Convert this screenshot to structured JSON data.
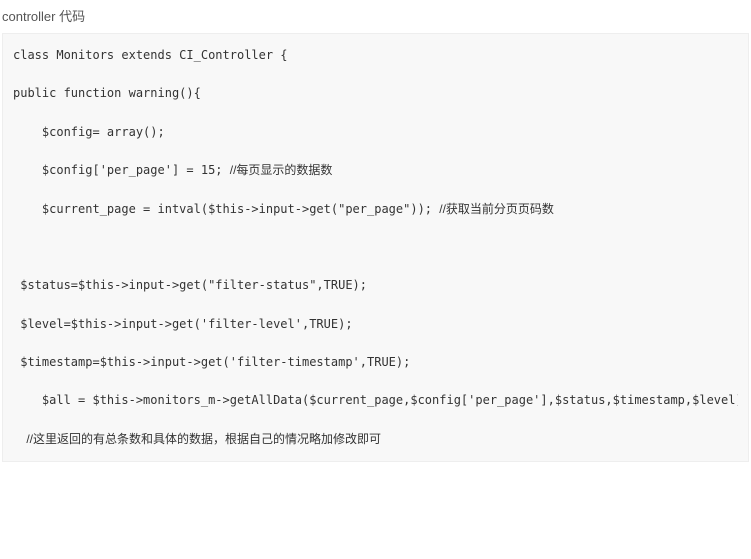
{
  "title": "controller 代码",
  "code": {
    "l1": "class Monitors extends CI_Controller {",
    "l2": "public function warning(){",
    "l3": "    $config= array();",
    "l4": "    $config['per_page'] = 15; ",
    "c4": "//每页显示的数据数",
    "l5": "    $current_page = intval($this->input->get(\"per_page\")); ",
    "c5": "//获取当前分页页码数",
    "l6": " $status=$this->input->get(\"filter-status\",TRUE);",
    "l7": " $level=$this->input->get('filter-level',TRUE);",
    "l8": " $timestamp=$this->input->get('filter-timestamp',TRUE);",
    "l9": "    $all = $this->monitors_m->getAllData($current_page,$config['per_page'],$status,$timestamp,$level);",
    "c10": "    //这里返回的有总条数和具体的数据，根据自己的情况略加修改即可"
  }
}
